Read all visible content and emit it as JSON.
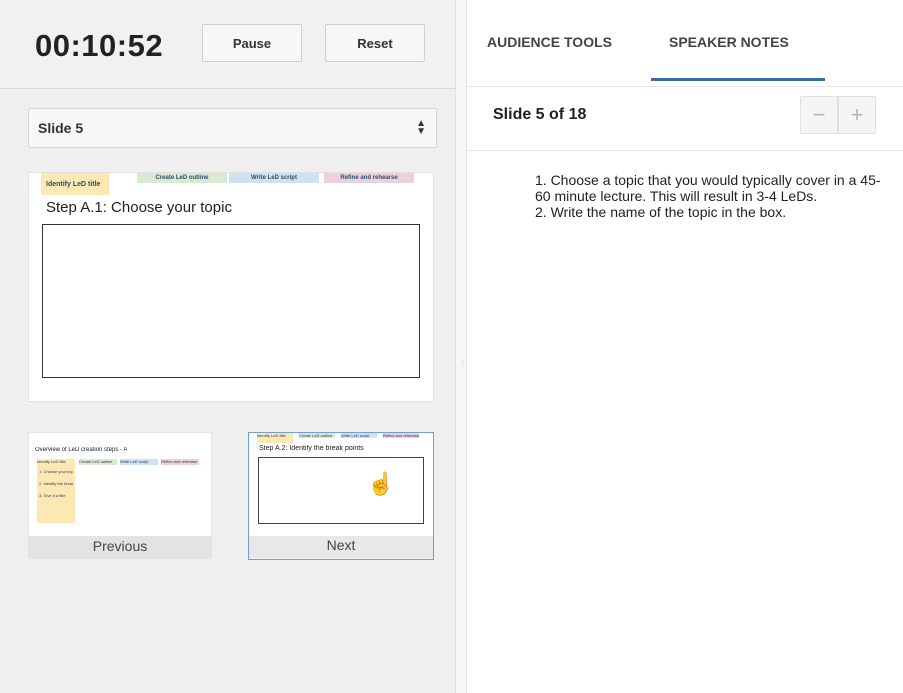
{
  "timer": {
    "value": "00:10:52"
  },
  "controls": {
    "pause_label": "Pause",
    "reset_label": "Reset"
  },
  "slide_select": {
    "value": "Slide 5"
  },
  "current_slide": {
    "tags": [
      "Identify LeD title",
      "Create LeD outline",
      "Write LeD script",
      "Refine and rehearse"
    ],
    "step": "Step A.1: Choose your topic"
  },
  "previous_slide": {
    "title": "Overview of LeD creation steps - A",
    "tags": [
      "Identify LeD title",
      "Create LeD outline",
      "Write LeD script",
      "Refine and rehearse"
    ],
    "items": [
      "1. Choose your topic",
      "2. Identify the break points",
      "3. Give it a title"
    ],
    "caption": "Previous"
  },
  "next_slide": {
    "tags": [
      "Identify LeD title",
      "Create LeD outline",
      "Write LeD script",
      "Refine and rehearse"
    ],
    "step": "Step A.2: Identify the break points",
    "caption": "Next"
  },
  "tabs": {
    "audience": "AUDIENCE TOOLS",
    "notes": "SPEAKER NOTES"
  },
  "speaker_notes": {
    "slide_count": "Slide 5 of 18",
    "zoom_out": "−",
    "zoom_in": "+",
    "lines": [
      "1. Choose a topic that you would typically cover in a 45-60 minute lecture. This will result in 3-4 LeDs.",
      "2. Write the name of the topic in the box."
    ]
  },
  "colors": {
    "accent": "#3b6aa0",
    "tag_yellow": "#fce8b2",
    "tag_green": "#d9ead3",
    "tag_blue": "#cfe2f3",
    "tag_pink": "#ead1dc"
  }
}
